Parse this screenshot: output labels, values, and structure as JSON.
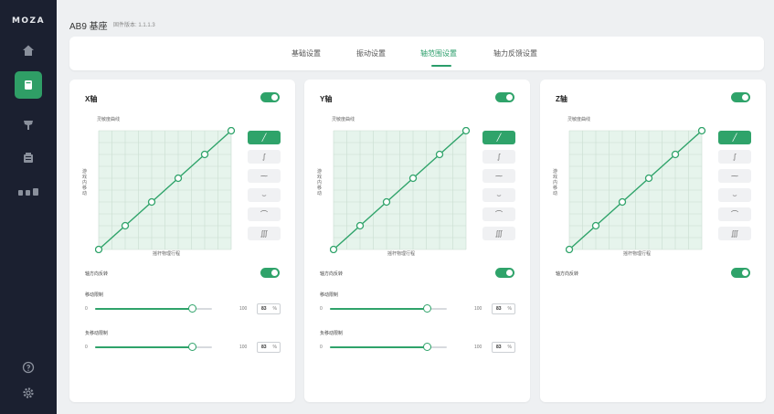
{
  "sidebar": {
    "logo": "MOZA",
    "icons": [
      "home-icon",
      "wheelbase-icon",
      "steering-wheel-icon",
      "dashboard-icon",
      "pedals-icon",
      "help-icon",
      "settings-icon"
    ]
  },
  "header": {
    "title": "AB9 基座",
    "version": "固件版本: 1.1.1.3"
  },
  "tabs": [
    "基础设置",
    "振动设置",
    "轴范围设置",
    "轴力反馈设置"
  ],
  "active_tab": "轴范围设置",
  "colors": {
    "accent": "#2fa36a",
    "grid_fill": "#e6f4ec",
    "sidebar": "#1b2030"
  },
  "panels": [
    {
      "title": "X轴",
      "enabled": true,
      "curve_label": "灵敏度曲线",
      "y_axis_label": "游戏内移动",
      "x_axis_label": "摇杆物理行程",
      "curve_points": [
        [
          0,
          0
        ],
        [
          20,
          20
        ],
        [
          40,
          40
        ],
        [
          60,
          60
        ],
        [
          80,
          80
        ],
        [
          100,
          100
        ]
      ],
      "curve_buttons": [
        "linear-curve-icon",
        "s-curve-icon",
        "exponential-curve-icon",
        "log-curve-icon",
        "concave-curve-icon",
        "custom-curve-icon"
      ],
      "active_curve": 0,
      "reverse_label": "轴方向反转",
      "reverse_on": true,
      "sliders": [
        {
          "label": "移动限制",
          "min": "0",
          "max": "100",
          "value": "83",
          "unit": "%",
          "fraction": 0.83
        },
        {
          "label": "负移动限制",
          "min": "0",
          "max": "100",
          "value": "83",
          "unit": "%",
          "fraction": 0.83
        }
      ]
    },
    {
      "title": "Y轴",
      "enabled": true,
      "curve_label": "灵敏度曲线",
      "y_axis_label": "游戏内移动",
      "x_axis_label": "摇杆物理行程",
      "curve_points": [
        [
          0,
          0
        ],
        [
          20,
          20
        ],
        [
          40,
          40
        ],
        [
          60,
          60
        ],
        [
          80,
          80
        ],
        [
          100,
          100
        ]
      ],
      "curve_buttons": [
        "linear-curve-icon",
        "s-curve-icon",
        "exponential-curve-icon",
        "log-curve-icon",
        "concave-curve-icon",
        "custom-curve-icon"
      ],
      "active_curve": 0,
      "reverse_label": "轴方向反转",
      "reverse_on": true,
      "sliders": [
        {
          "label": "移动限制",
          "min": "0",
          "max": "100",
          "value": "83",
          "unit": "%",
          "fraction": 0.83
        },
        {
          "label": "负移动限制",
          "min": "0",
          "max": "100",
          "value": "83",
          "unit": "%",
          "fraction": 0.83
        }
      ]
    },
    {
      "title": "Z轴",
      "enabled": true,
      "curve_label": "灵敏度曲线",
      "y_axis_label": "游戏内移动",
      "x_axis_label": "摇杆物理行程",
      "curve_points": [
        [
          0,
          0
        ],
        [
          20,
          20
        ],
        [
          40,
          40
        ],
        [
          60,
          60
        ],
        [
          80,
          80
        ],
        [
          100,
          100
        ]
      ],
      "curve_buttons": [
        "linear-curve-icon",
        "s-curve-icon",
        "exponential-curve-icon",
        "log-curve-icon",
        "concave-curve-icon",
        "custom-curve-icon"
      ],
      "active_curve": 0,
      "reverse_label": "轴方向反转",
      "reverse_on": true,
      "sliders": []
    }
  ]
}
